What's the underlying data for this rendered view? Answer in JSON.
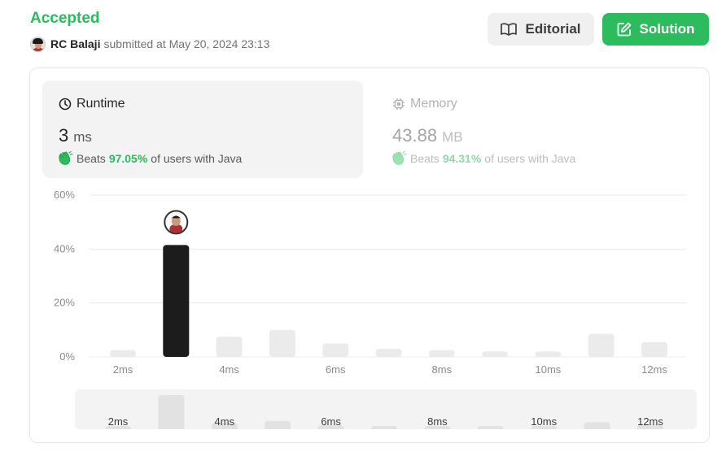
{
  "header": {
    "status": "Accepted",
    "username": "RC Balaji",
    "submitted_text": "submitted at May 20, 2024 23:13"
  },
  "buttons": {
    "editorial": "Editorial",
    "solution": "Solution"
  },
  "runtime": {
    "label": "Runtime",
    "value": "3",
    "unit": "ms",
    "beats_prefix": "Beats",
    "beats_pct": "97.05%",
    "beats_suffix": "of users with Java"
  },
  "memory": {
    "label": "Memory",
    "value": "43.88",
    "unit": "MB",
    "beats_prefix": "Beats",
    "beats_pct": "94.31%",
    "beats_suffix": "of users with Java"
  },
  "colors": {
    "accent": "#2cbb5d",
    "highlight_bar": "#1c1c1c",
    "bar": "#ebebeb"
  },
  "chart_data": {
    "type": "bar",
    "categories": [
      "2ms",
      "3ms",
      "4ms",
      "5ms",
      "6ms",
      "7ms",
      "8ms",
      "9ms",
      "10ms",
      "11ms",
      "12ms"
    ],
    "values": [
      2.5,
      41.5,
      7.5,
      10,
      5,
      3,
      2.5,
      2,
      2,
      8.5,
      5.5
    ],
    "highlight_index": 1,
    "y_ticks": [
      "0%",
      "20%",
      "40%",
      "60%"
    ],
    "x_tick_labels": [
      "2ms",
      "",
      "4ms",
      "",
      "6ms",
      "",
      "8ms",
      "",
      "10ms",
      "",
      "12ms"
    ],
    "ylim": [
      0,
      60
    ],
    "grid": true
  },
  "navigator": {
    "labels": [
      "2ms",
      "4ms",
      "6ms",
      "8ms",
      "10ms",
      "12ms"
    ]
  }
}
